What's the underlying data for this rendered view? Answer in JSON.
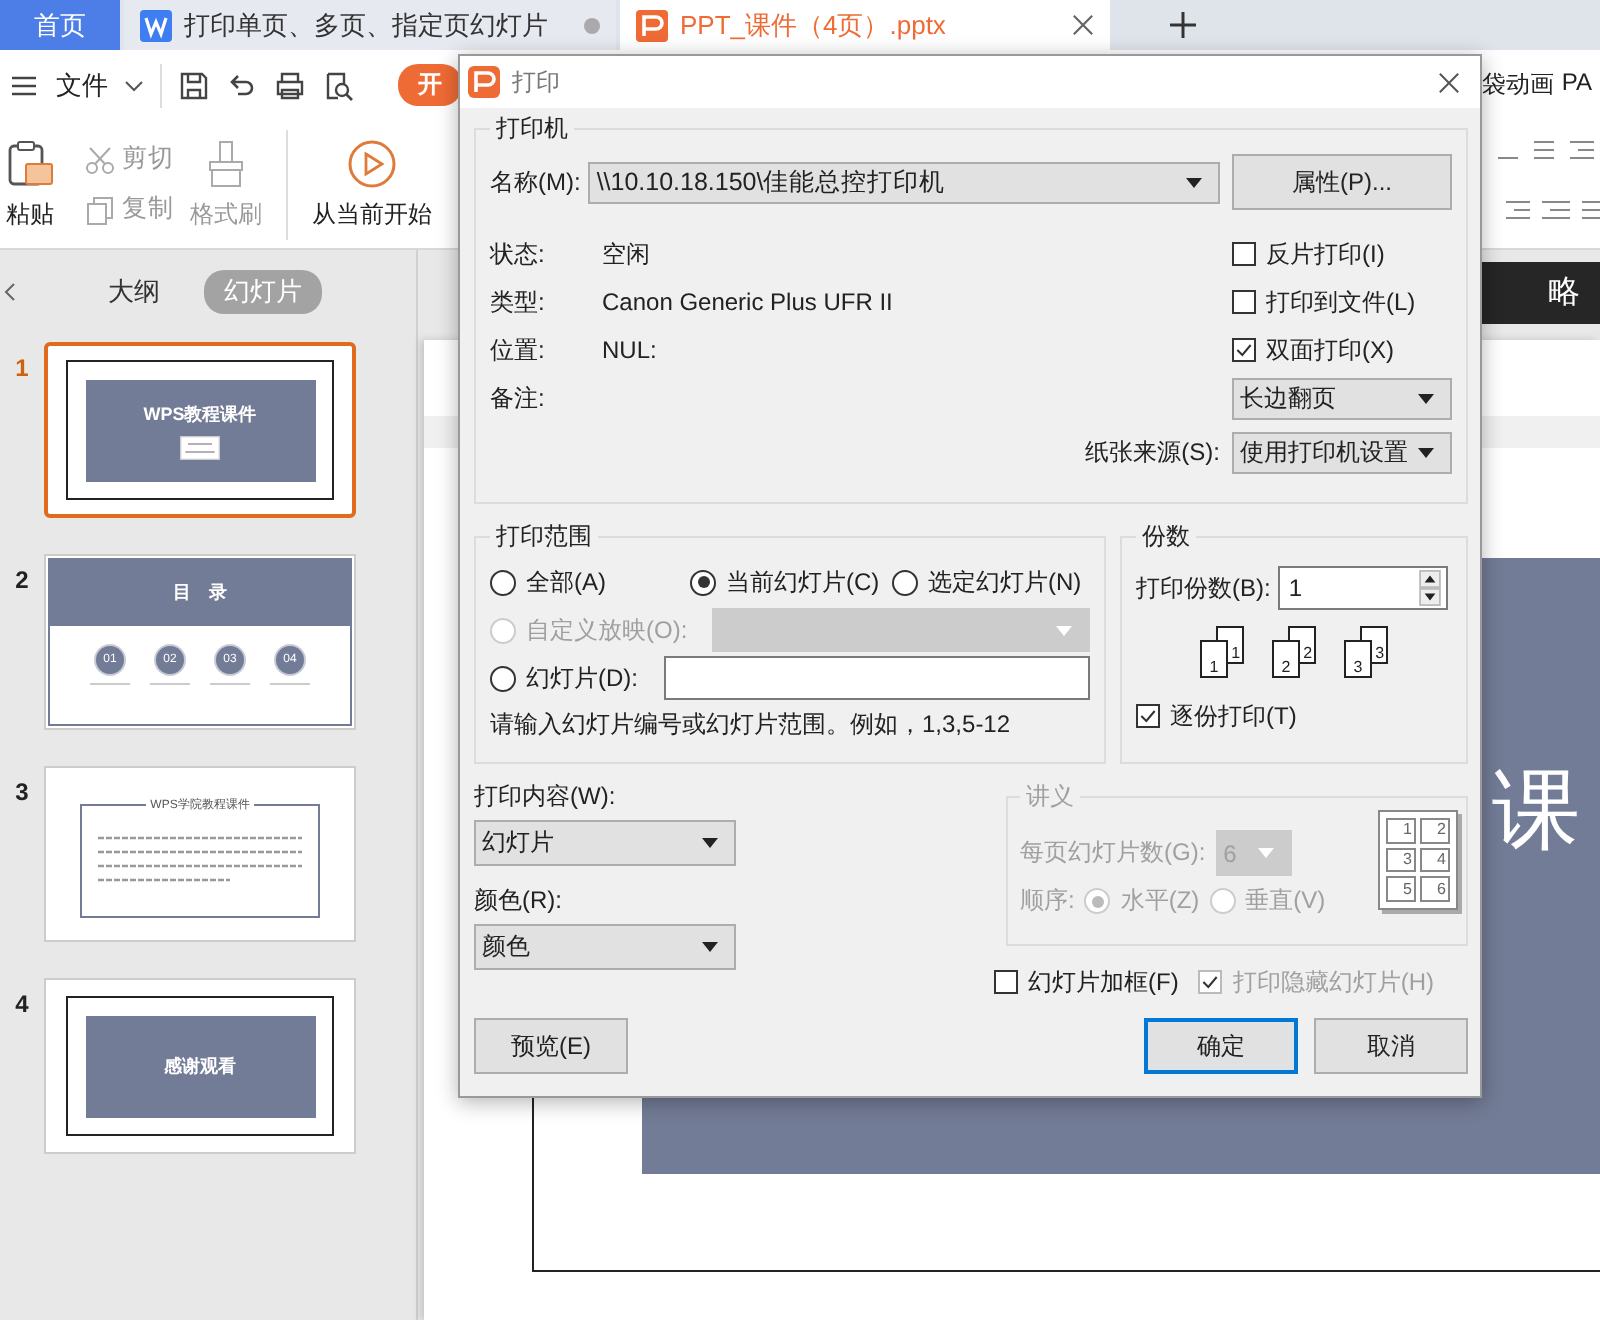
{
  "tabs": [
    {
      "label": "首页",
      "selected": false,
      "kind": "home"
    },
    {
      "label": "打印单页、多页、指定页幻灯片",
      "selected": false,
      "kind": "doc"
    },
    {
      "label": "PPT_课件（4页）.pptx",
      "selected": true,
      "kind": "ppt"
    }
  ],
  "menu": {
    "file": "文件",
    "ribbon_tab": {
      "label": "开",
      "selected": true
    },
    "right_tabs": [
      {
        "label": "袋动画",
        "selected": false
      },
      {
        "label": "PA",
        "selected": false
      }
    ]
  },
  "ribbon": {
    "paste": "粘贴",
    "cut": "剪切",
    "copy": "复制",
    "format_painter": "格式刷",
    "play": "从当前开始"
  },
  "panel": {
    "tabs": [
      {
        "label": "大纲",
        "selected": false
      },
      {
        "label": "幻灯片",
        "selected": true
      }
    ],
    "slides": [
      {
        "number": "1",
        "selected": true,
        "kind": "title",
        "title": "WPS教程课件"
      },
      {
        "number": "2",
        "selected": false,
        "kind": "toc",
        "title": "目　录",
        "items": [
          "01",
          "02",
          "03",
          "04"
        ]
      },
      {
        "number": "3",
        "selected": false,
        "kind": "text",
        "title": "WPS学院教程课件"
      },
      {
        "number": "4",
        "selected": false,
        "kind": "title",
        "title": "感谢观看"
      }
    ]
  },
  "canvas": {
    "toolbar_button": "略",
    "slide_text": "课"
  },
  "dialog": {
    "title": "打印",
    "printer": {
      "legend": "打印机",
      "name_label": "名称(M):",
      "name": "\\\\10.10.18.150\\佳能总控打印机",
      "properties": "属性(P)...",
      "info": [
        {
          "label": "状态:",
          "value": "空闲"
        },
        {
          "label": "类型:",
          "value": "Canon Generic Plus UFR II"
        },
        {
          "label": "位置:",
          "value": "NUL:"
        },
        {
          "label": "备注:"
        }
      ],
      "options": [
        {
          "label": "反片打印(I)",
          "checked": false
        },
        {
          "label": "打印到文件(L)",
          "checked": false
        },
        {
          "label": "双面打印(X)",
          "checked": true
        }
      ],
      "duplex": "长边翻页",
      "source_label": "纸张来源(S):",
      "source": "使用打印机设置"
    },
    "range": {
      "legend": "打印范围",
      "options": [
        {
          "label": "全部(A)",
          "selected": false,
          "disabled": false
        },
        {
          "label": "当前幻灯片(C)",
          "selected": true,
          "disabled": false
        },
        {
          "label": "选定幻灯片(N)",
          "selected": false,
          "disabled": false
        },
        {
          "label": "自定义放映(O):",
          "selected": false,
          "disabled": true
        },
        {
          "label": "幻灯片(D):",
          "selected": false,
          "disabled": false
        }
      ],
      "hint": "请输入幻灯片编号或幻灯片范围。例如，1,3,5-12"
    },
    "copies": {
      "legend": "份数",
      "label": "打印份数(B):",
      "value": "1",
      "pages": [
        [
          "1",
          "1"
        ],
        [
          "2",
          "2"
        ],
        [
          "3",
          "3"
        ]
      ],
      "collate": {
        "label": "逐份打印(T)",
        "checked": true
      }
    },
    "content": {
      "label": "打印内容(W):",
      "value": "幻灯片"
    },
    "color": {
      "label": "颜色(R):",
      "value": "颜色"
    },
    "handout": {
      "legend": "讲义",
      "disabled": true,
      "per_page_label": "每页幻灯片数(G):",
      "per_page": "6",
      "order_label": "顺序:",
      "order": [
        {
          "label": "水平(Z)",
          "selected": true
        },
        {
          "label": "垂直(V)",
          "selected": false
        }
      ],
      "preview": [
        "1",
        "2",
        "3",
        "4",
        "5",
        "6"
      ]
    },
    "frame": {
      "label": "幻灯片加框(F)",
      "checked": false,
      "disabled": false
    },
    "hidden": {
      "label": "打印隐藏幻灯片(H)",
      "checked": true,
      "disabled": true
    },
    "buttons": [
      {
        "label": "预览(E)",
        "kind": "preview"
      },
      {
        "label": "确定",
        "kind": "default"
      },
      {
        "label": "取消",
        "kind": "normal"
      }
    ]
  }
}
